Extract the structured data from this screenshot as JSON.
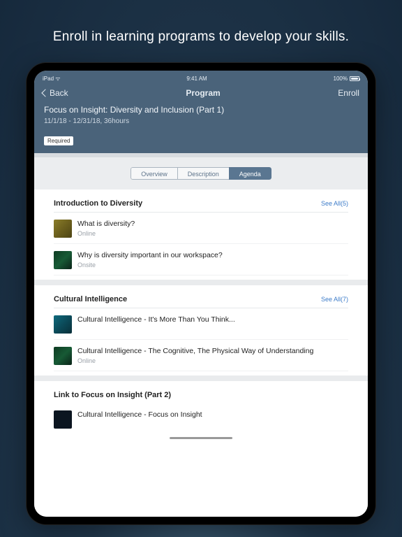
{
  "headline": "Enroll in learning programs to develop your skills.",
  "status": {
    "carrier": "iPad ᯤ",
    "time": "9:41 AM",
    "pct": "100%"
  },
  "nav": {
    "back": "Back",
    "title": "Program",
    "enroll": "Enroll"
  },
  "program": {
    "title": "Focus on Insight: Diversity and Inclusion (Part 1)",
    "subtitle": "11/1/18 - 12/31/18, 36hours",
    "required": "Required"
  },
  "tabs": {
    "a": "Overview",
    "b": "Description",
    "c": "Agenda"
  },
  "sections": [
    {
      "title": "Introduction to Diversity",
      "link": "See All(5)",
      "items": [
        {
          "name": "What is diversity?",
          "sub": "Online"
        },
        {
          "name": "Why is diversity important in our workspace?",
          "sub": "Onsite"
        }
      ]
    },
    {
      "title": "Cultural Intelligence",
      "link": "See All(7)",
      "items": [
        {
          "name": "Cultural Intelligence - It's More Than You Think...",
          "sub": ""
        },
        {
          "name": "Cultural Intelligence - The Cognitive, The Physical Way of Understanding",
          "sub": "Online"
        }
      ]
    }
  ],
  "lastSection": {
    "title": "Link to Focus on Insight (Part 2)",
    "item": {
      "name": "Cultural Intelligence - Focus on Insight"
    }
  }
}
